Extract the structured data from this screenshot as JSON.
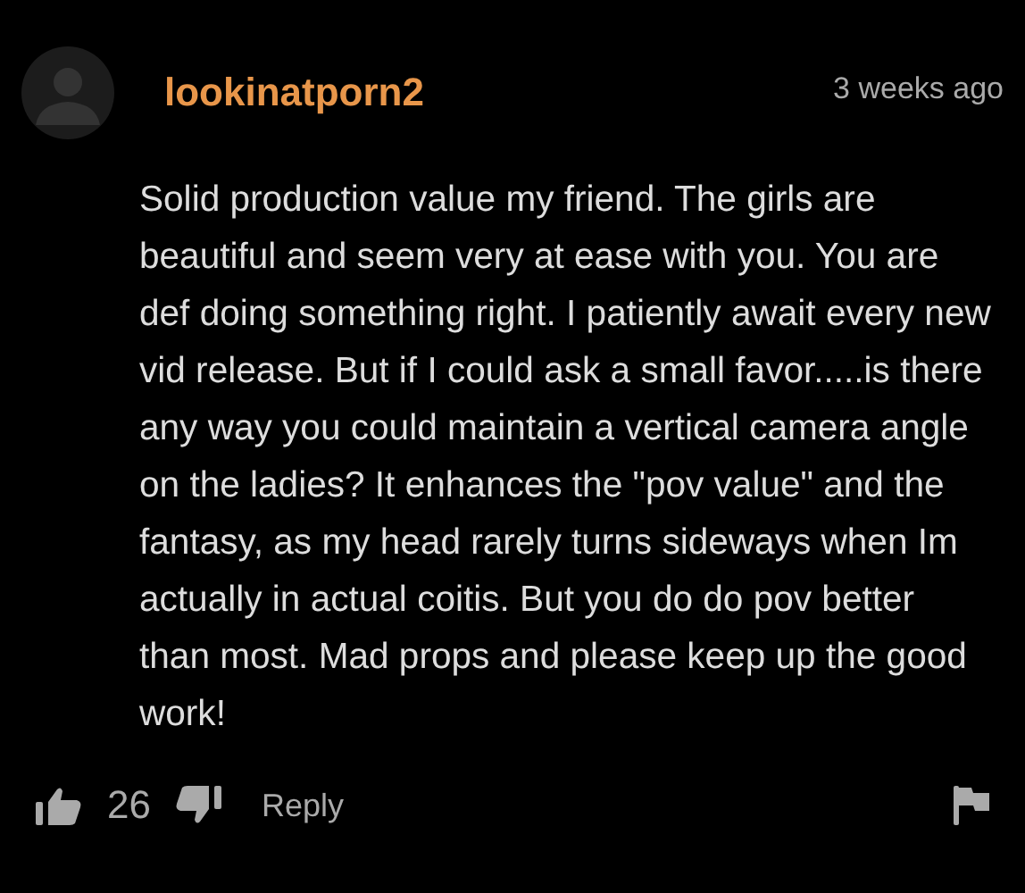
{
  "comment": {
    "username": "lookinatporn2",
    "time": "3 weeks ago",
    "text": "Solid production value my friend. The girls are beautiful and seem very at ease with you. You are def doing something right. I patiently await every new vid release. But if I could ask a small favor.....is there any way you could maintain a vertical camera angle on the ladies? It enhances the \"pov value\" and the fantasy, as my head rarely turns sideways when Im actually in actual coitis. But you do do pov better than most. Mad props and please keep up the good work!",
    "likes": "26",
    "reply": "Reply"
  }
}
